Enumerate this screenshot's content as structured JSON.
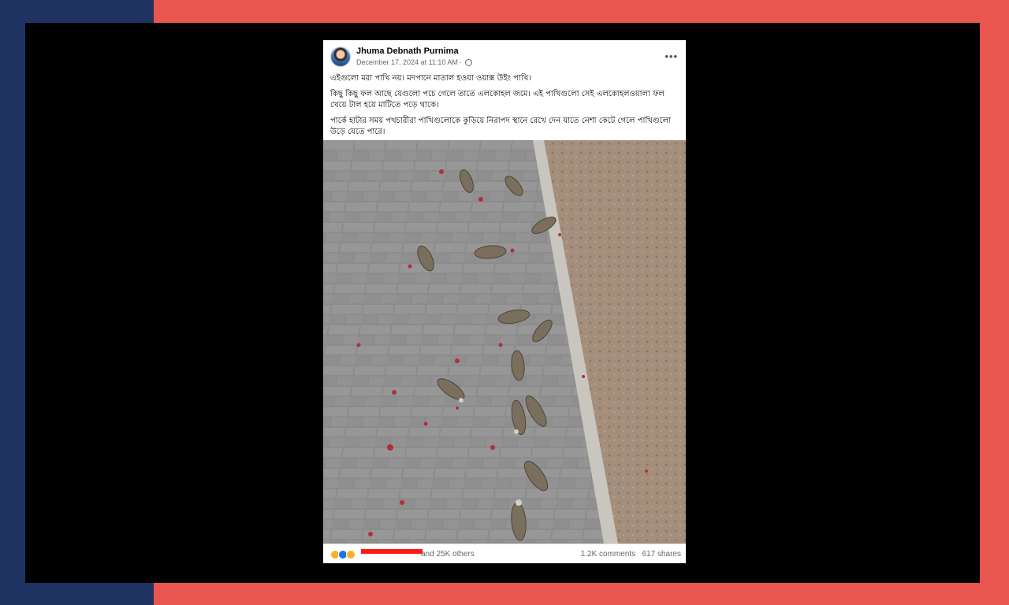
{
  "post": {
    "author": "Jhuma Debnath Purnima",
    "timestamp": "December 17, 2024 at 11:10 AM",
    "separator": "·",
    "more_label": "•••",
    "paragraphs": [
      "এইগুলো মরা পাখি নয়। মদপানে মাতাল হওয়া ওয়াক্স উইং পাখি।",
      "কিছু কিছু ফল আছে যেগুলো পচে গেলে তাতে এলকোহল জমে। এই পাখিগুলো সেই এলকোহলওয়ালা ফল খেয়ে টাল হয়ে মাটিতে পড়ে থাকে।",
      "পার্কে হাটার সময় পথচারীরা পাখিগুলোকে কুড়িয়ে নিরাপদ স্থানে রেখে দেন যাতে নেশা কেটে গেলে পাখিগুলো উড়ে যেতে পারে।"
    ],
    "photo_icon": "photo-of-waxwing-birds-on-pavement",
    "reactions": [
      "haha-icon",
      "like-icon",
      "wow-icon"
    ],
    "others_text": "and 25K others",
    "comments": "1.2K comments",
    "shares": "617 shares"
  },
  "colors": {
    "background_red": "#e9564f",
    "band_navy": "#1f3363",
    "frame_black": "#000000",
    "redaction": "#ff1a1a"
  }
}
